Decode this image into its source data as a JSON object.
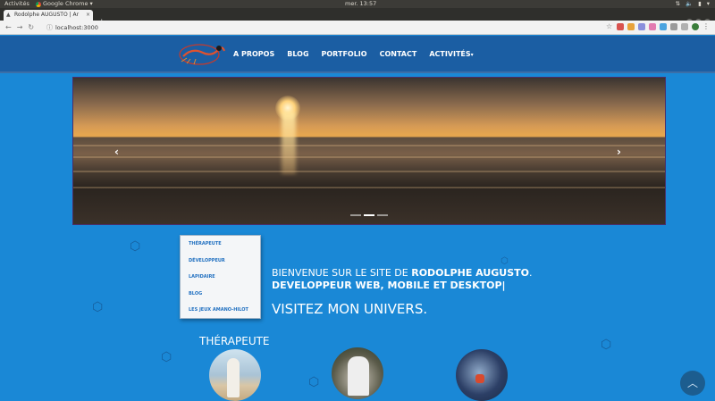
{
  "os": {
    "activities": "Activités",
    "app_name": "Google Chrome",
    "clock": "mer. 13:57"
  },
  "browser": {
    "tab_title": "Rodolphe AUGUSTO | Ar",
    "url": "localhost:3000"
  },
  "nav": {
    "items": [
      "A PROPOS",
      "BLOG",
      "PORTFOLIO",
      "CONTACT",
      "ACTIVITÉS"
    ]
  },
  "dropdown": {
    "items": [
      "THÉRAPEUTE",
      "DÉVELOPPEUR",
      "LAPIDAIRE",
      "BLOG",
      "LES JEUX AMANO-HILOT"
    ]
  },
  "welcome": {
    "prefix": "BIENVENUE SUR LE SITE DE",
    "name": "RODOLPHE AUGUSTO",
    "line2": "DEVELOPPEUR WEB, MOBILE ET DESKTOP|",
    "cta": "VISITEZ MON UNIVERS."
  },
  "sections": {
    "therapeute_title": "THÉRAPEUTE"
  },
  "carousel": {
    "slide_count": 3,
    "active_index": 1
  },
  "colors": {
    "page_bg": "#1a88d6",
    "header_bg": "#1b5ea3",
    "dropdown_link": "#1f6fc0"
  }
}
